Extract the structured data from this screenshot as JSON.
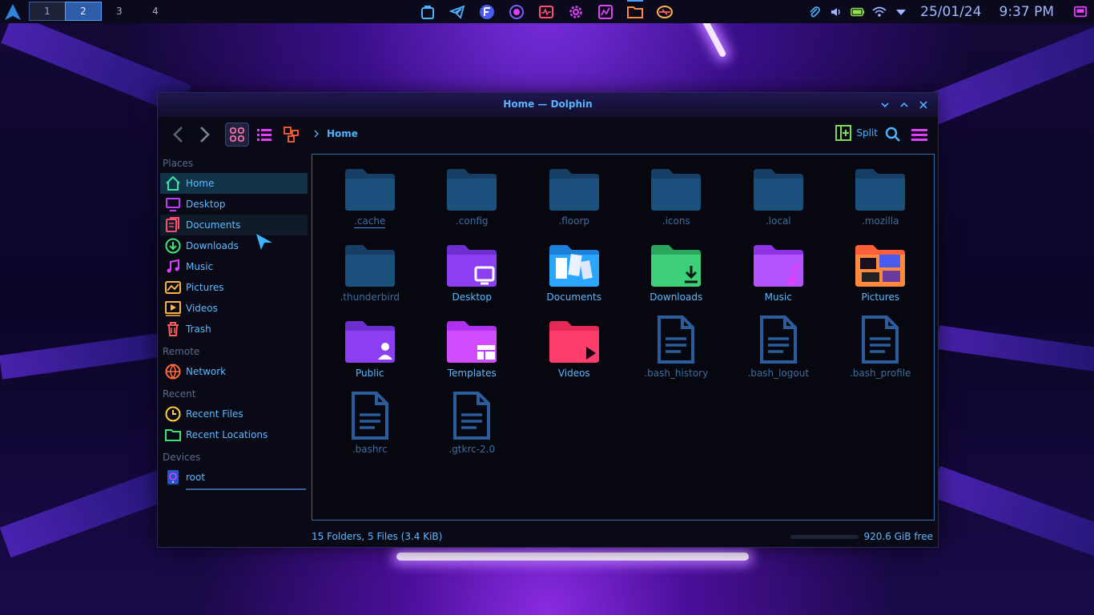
{
  "panel": {
    "workspaces": [
      "1",
      "2",
      "3",
      "4"
    ],
    "active_workspace": "2",
    "tasks": [
      "app-store-icon",
      "telegram-icon",
      "floorp-icon",
      "browser-icon",
      "system-monitor-icon",
      "settings-gear-icon",
      "activity-chart-icon",
      "dolphin-folder-icon",
      "network-icon"
    ],
    "date": "25/01/24",
    "time": "9:37 PM"
  },
  "window": {
    "title": "Home — Dolphin",
    "breadcrumb": "Home",
    "split_label": "Split"
  },
  "sidebar": {
    "places_label": "Places",
    "places": [
      {
        "label": "Home",
        "icon": "home-icon"
      },
      {
        "label": "Desktop",
        "icon": "desktop-icon"
      },
      {
        "label": "Documents",
        "icon": "documents-icon"
      },
      {
        "label": "Downloads",
        "icon": "downloads-icon"
      },
      {
        "label": "Music",
        "icon": "music-icon"
      },
      {
        "label": "Pictures",
        "icon": "pictures-icon"
      },
      {
        "label": "Videos",
        "icon": "videos-icon"
      },
      {
        "label": "Trash",
        "icon": "trash-icon"
      }
    ],
    "remote_label": "Remote",
    "remote": [
      {
        "label": "Network",
        "icon": "network-icon"
      }
    ],
    "recent_label": "Recent",
    "recent": [
      {
        "label": "Recent Files",
        "icon": "clock-icon"
      },
      {
        "label": "Recent Locations",
        "icon": "folder-icon"
      }
    ],
    "devices_label": "Devices",
    "devices": [
      {
        "label": "root",
        "icon": "drive-icon"
      }
    ]
  },
  "files": [
    {
      "name": ".cache",
      "kind": "hidden"
    },
    {
      "name": ".config",
      "kind": "hidden"
    },
    {
      "name": ".floorp",
      "kind": "hidden"
    },
    {
      "name": ".icons",
      "kind": "hidden"
    },
    {
      "name": ".local",
      "kind": "hidden"
    },
    {
      "name": ".mozilla",
      "kind": "hidden"
    },
    {
      "name": ".thunderbird",
      "kind": "hidden"
    },
    {
      "name": "Desktop",
      "kind": "desktop"
    },
    {
      "name": "Documents",
      "kind": "documents"
    },
    {
      "name": "Downloads",
      "kind": "downloads"
    },
    {
      "name": "Music",
      "kind": "music"
    },
    {
      "name": "Pictures",
      "kind": "pictures"
    },
    {
      "name": "Public",
      "kind": "public"
    },
    {
      "name": "Templates",
      "kind": "templates"
    },
    {
      "name": "Videos",
      "kind": "videos"
    },
    {
      "name": ".bash_history",
      "kind": "file"
    },
    {
      "name": ".bash_logout",
      "kind": "file"
    },
    {
      "name": ".bash_profile",
      "kind": "file"
    },
    {
      "name": ".bashrc",
      "kind": "file"
    },
    {
      "name": ".gtkrc-2.0",
      "kind": "file"
    }
  ],
  "status": {
    "summary": "15 Folders, 5 Files (3.4 KiB)",
    "free_space": "920.6 GiB free"
  },
  "colors": {
    "accent": "#4fb2ff",
    "hidden_folder": "#1b4f7c",
    "purple_folder": "#a855f7",
    "magenta": "#e040fb"
  }
}
